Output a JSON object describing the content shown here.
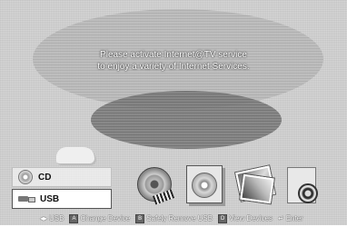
{
  "message": {
    "line1": "Please activate Internet@TV service",
    "line2": "to enjoy a variety of Internet Services."
  },
  "source_menu": {
    "items": [
      {
        "label": "CD",
        "icon": "disc-icon",
        "selected": false
      },
      {
        "label": "USB",
        "icon": "usb-icon",
        "selected": true
      }
    ]
  },
  "apps": [
    {
      "icon": "film-reel-icon"
    },
    {
      "icon": "music-cd-icon"
    },
    {
      "icon": "photo-icon"
    },
    {
      "icon": "settings-icon"
    }
  ],
  "help_bar": {
    "usb_label": "USB",
    "change_device": "Change Device",
    "safely_remove": "Safely Remove USB",
    "view_devices": "View Devices",
    "enter": "Enter",
    "key_a": "A",
    "key_b": "B",
    "key_d": "D"
  }
}
